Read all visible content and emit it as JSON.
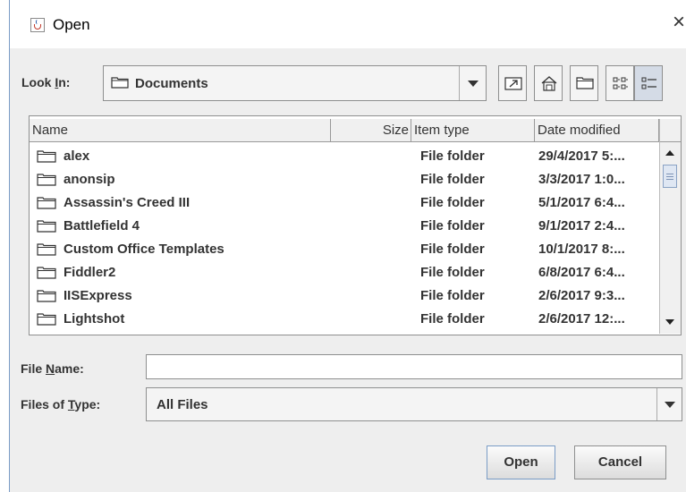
{
  "window": {
    "title": "Open",
    "close_glyph": "×"
  },
  "look_in": {
    "label_pre": "Look ",
    "label_key": "I",
    "label_post": "n:",
    "value": "Documents"
  },
  "toolbar": {
    "icons": [
      "up-one-level-icon",
      "home-icon",
      "new-folder-icon",
      "list-view-icon",
      "details-view-icon"
    ],
    "selected": "details-view-icon"
  },
  "table": {
    "columns": {
      "name": "Name",
      "size": "Size",
      "type": "Item type",
      "date": "Date modified"
    },
    "rows": [
      {
        "name": "alex",
        "type": "File folder",
        "date": "29/4/2017 5:..."
      },
      {
        "name": "anonsip",
        "type": "File folder",
        "date": "3/3/2017 1:0..."
      },
      {
        "name": "Assassin's Creed III",
        "type": "File folder",
        "date": "5/1/2017 6:4..."
      },
      {
        "name": "Battlefield 4",
        "type": "File folder",
        "date": "9/1/2017 2:4..."
      },
      {
        "name": "Custom Office Templates",
        "type": "File folder",
        "date": "10/1/2017 8:..."
      },
      {
        "name": "Fiddler2",
        "type": "File folder",
        "date": "6/8/2017 6:4..."
      },
      {
        "name": "IISExpress",
        "type": "File folder",
        "date": "2/6/2017 9:3..."
      },
      {
        "name": "Lightshot",
        "type": "File folder",
        "date": "2/6/2017 12:..."
      }
    ]
  },
  "file_name": {
    "label_pre": "File ",
    "label_key": "N",
    "label_post": "ame:",
    "value": ""
  },
  "file_type": {
    "label_pre": "Files of ",
    "label_key": "T",
    "label_post": "ype:",
    "value": "All Files"
  },
  "buttons": {
    "open": "Open",
    "cancel": "Cancel"
  },
  "colors": {
    "dialog_bg": "#eeeeee",
    "border": "#8e8f8f",
    "focus_border": "#7a9cc6",
    "text": "#333333"
  }
}
